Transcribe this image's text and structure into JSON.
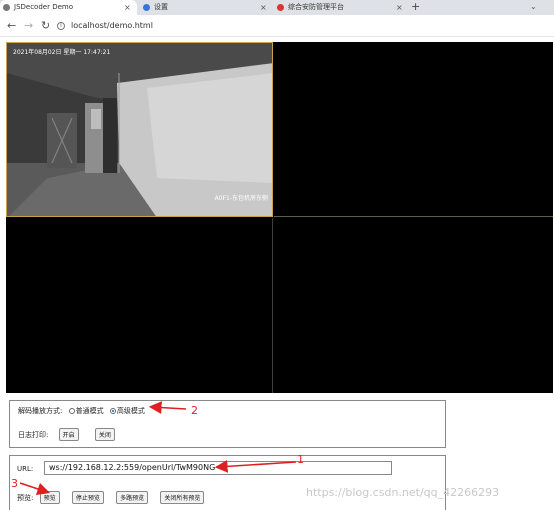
{
  "browser": {
    "tabs": [
      {
        "title": "JSDecoder Demo",
        "active": true
      },
      {
        "title": "设置",
        "active": false
      },
      {
        "title": "综合安防管理平台",
        "active": false
      }
    ],
    "close_glyph": "×",
    "new_tab_glyph": "+",
    "url": "localhost/demo.html",
    "window_control_glyph": "⌄"
  },
  "player": {
    "osd_time": "2021年08月02日 星期一 17:47:21",
    "osd_name": "A0F1-东包机房东侧"
  },
  "controls": {
    "decode_label": "解码播放方式:",
    "mode_normal": "普通模式",
    "mode_advanced": "高级模式",
    "selected_mode": "advanced",
    "log_label": "日志打印:",
    "log_on": "开启",
    "log_off": "关闭"
  },
  "preview": {
    "url_label": "URL:",
    "url_value": "ws://192.168.12.2:559/openUrl/TwM90NG",
    "preview_label": "预览:",
    "btn_preview": "预览",
    "btn_stop": "停止预览",
    "btn_multi": "多路预览",
    "btn_close_all": "关闭所有预览"
  },
  "annotations": {
    "a1": "1",
    "a2": "2",
    "a3": "3"
  },
  "watermark": "https://blog.csdn.net/qq_42266293",
  "colors": {
    "arrow": "#e02020",
    "accent": "#1a5cd6",
    "pane_border": "#c8a44a"
  }
}
